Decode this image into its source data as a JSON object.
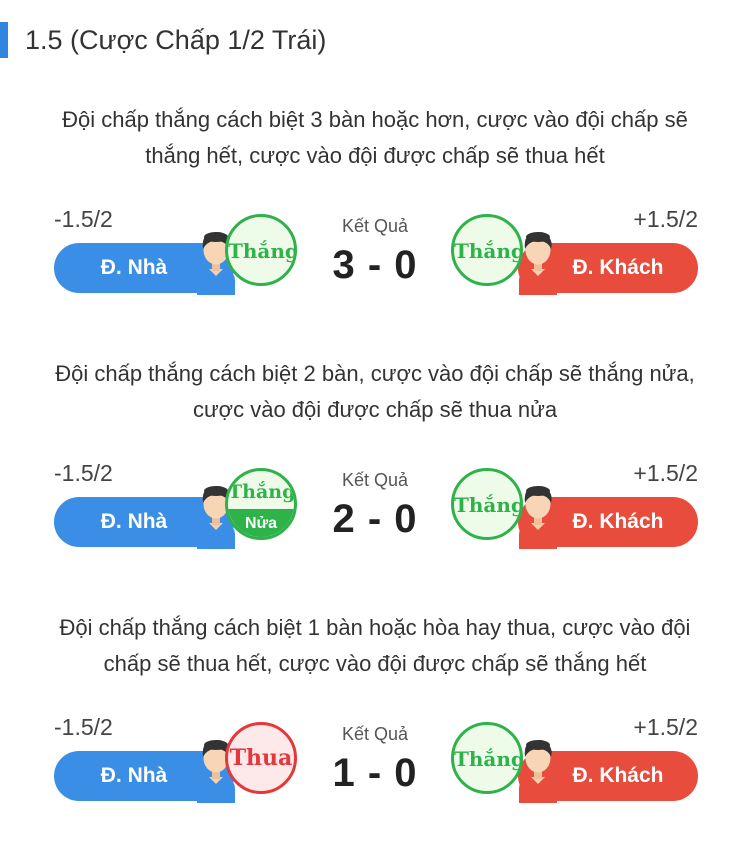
{
  "title": "1.5 (Cược Chấp 1/2 Trái)",
  "scenarios": [
    {
      "description": "Đội chấp thắng cách biệt 3 bàn hoặc hơn, cược vào đội chấp sẽ thắng hết, cược vào đội được chấp sẽ thua hết",
      "home": {
        "handicap": "-1.5/2",
        "label": "Đ. Nhà",
        "outcome": "Thắng"
      },
      "away": {
        "handicap": "+1.5/2",
        "label": "Đ. Khách",
        "outcome": "Thắng"
      },
      "result_label": "Kết Quả",
      "score": "3 - 0"
    },
    {
      "description": "Đội chấp thắng cách biệt 2 bàn, cược vào đội chấp sẽ thắng nửa, cược vào đội được chấp sẽ thua nửa",
      "home": {
        "handicap": "-1.5/2",
        "label": "Đ. Nhà",
        "outcome": "Thắng",
        "outcome_sub": "Nửa"
      },
      "away": {
        "handicap": "+1.5/2",
        "label": "Đ. Khách",
        "outcome": "Thắng"
      },
      "result_label": "Kết Quả",
      "score": "2 - 0"
    },
    {
      "description": "Đội chấp thắng cách biệt 1 bàn hoặc hòa hay thua, cược vào đội chấp sẽ thua hết, cược vào đội được chấp sẽ thắng hết",
      "home": {
        "handicap": "-1.5/2",
        "label": "Đ. Nhà",
        "outcome": "Thua"
      },
      "away": {
        "handicap": "+1.5/2",
        "label": "Đ. Khách",
        "outcome": "Thắng"
      },
      "result_label": "Kết Quả",
      "score": "1 - 0"
    }
  ],
  "colors": {
    "accent": "#2e86de",
    "home": "#3b8ee6",
    "away": "#e74c3c",
    "win": "#2eb24a",
    "lose": "#e5383b"
  },
  "icons": {
    "home_avatar": "player-blue-jersey-icon",
    "away_avatar": "player-red-jersey-icon"
  }
}
